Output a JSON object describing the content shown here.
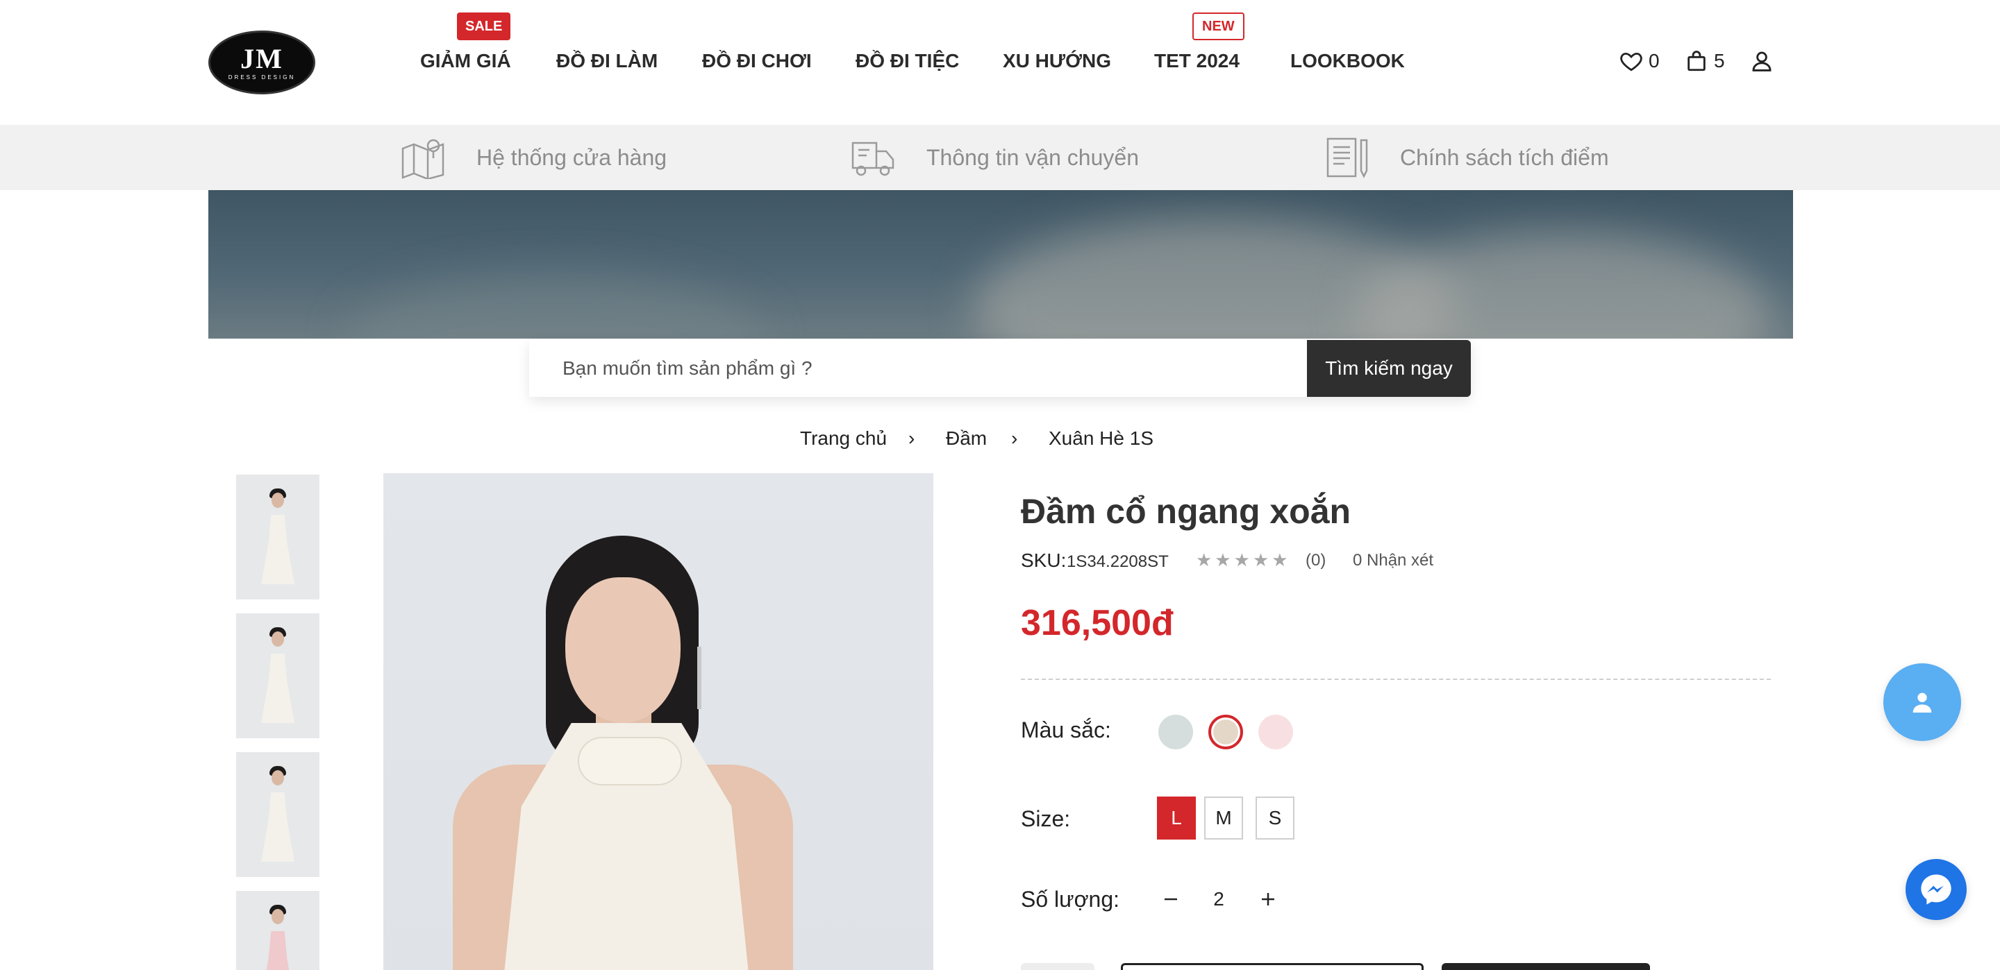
{
  "brand": {
    "logo_text": "JM",
    "logo_subtext": "DRESS DESIGN"
  },
  "nav": {
    "items": [
      {
        "label": "GIẢM GIÁ",
        "badge": "SALE"
      },
      {
        "label": "ĐỒ ĐI LÀM"
      },
      {
        "label": "ĐỒ ĐI CHƠI"
      },
      {
        "label": "ĐỒ ĐI TIỆC"
      },
      {
        "label": "XU HƯỚNG"
      },
      {
        "label": "TET 2024",
        "badge": "NEW"
      },
      {
        "label": "LOOKBOOK"
      }
    ]
  },
  "header_icons": {
    "wishlist_count": "0",
    "cart_count": "5",
    "icons": [
      "heart-icon",
      "bag-icon",
      "user-icon"
    ]
  },
  "infobar": {
    "items": [
      {
        "label": "Hệ thống cửa hàng",
        "icon": "map-icon"
      },
      {
        "label": "Thông tin vận chuyển",
        "icon": "truck-icon"
      },
      {
        "label": "Chính sách tích điểm",
        "icon": "document-icon"
      }
    ]
  },
  "search": {
    "placeholder": "Bạn muốn tìm sản phẩm gì ?",
    "button_label": "Tìm kiếm ngay"
  },
  "breadcrumb": {
    "items": [
      "Trang chủ",
      "Đầm",
      "Xuân Hè 1S"
    ],
    "separator": "›"
  },
  "product": {
    "title": "Đầm cổ ngang xoắn",
    "sku_label": "SKU:",
    "sku": "1S34.2208ST",
    "stars": "★★★★★",
    "rating_count": "(0)",
    "reviews": "0 Nhận xét",
    "price": "316,500đ",
    "color_label": "Màu sắc:",
    "colors": [
      "#d5dedd",
      "#e4d7c8",
      "#f8e0e2"
    ],
    "selected_color_index": 1,
    "size_label": "Size:",
    "sizes": [
      "L",
      "M",
      "S"
    ],
    "selected_size": "L",
    "qty_label": "Số lượng:",
    "quantity": "2"
  },
  "theme": {
    "accent": "#d3272b",
    "dark": "#2f2f2f",
    "info_bg": "#f1f1f1",
    "float_user": "#5aaef2",
    "float_msg": "#1f74e6"
  }
}
